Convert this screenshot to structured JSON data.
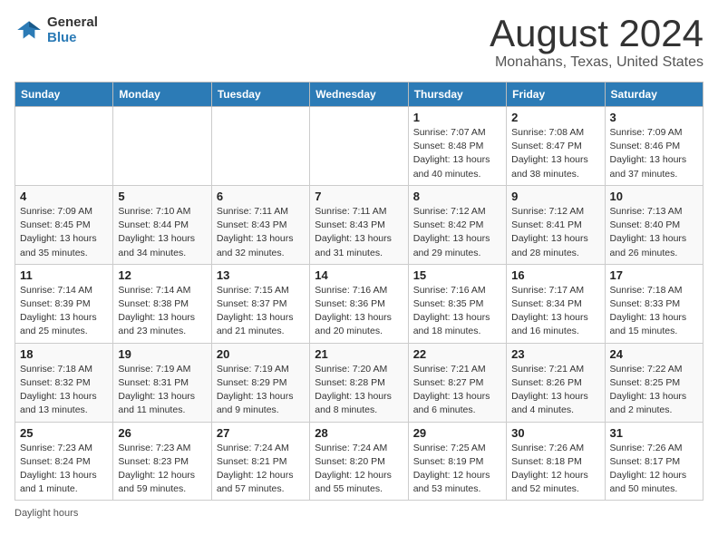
{
  "header": {
    "logo_line1": "General",
    "logo_line2": "Blue",
    "month_year": "August 2024",
    "location": "Monahans, Texas, United States"
  },
  "days_of_week": [
    "Sunday",
    "Monday",
    "Tuesday",
    "Wednesday",
    "Thursday",
    "Friday",
    "Saturday"
  ],
  "footer": {
    "daylight_label": "Daylight hours"
  },
  "weeks": [
    [
      {
        "day": "",
        "info": ""
      },
      {
        "day": "",
        "info": ""
      },
      {
        "day": "",
        "info": ""
      },
      {
        "day": "",
        "info": ""
      },
      {
        "day": "1",
        "info": "Sunrise: 7:07 AM\nSunset: 8:48 PM\nDaylight: 13 hours\nand 40 minutes."
      },
      {
        "day": "2",
        "info": "Sunrise: 7:08 AM\nSunset: 8:47 PM\nDaylight: 13 hours\nand 38 minutes."
      },
      {
        "day": "3",
        "info": "Sunrise: 7:09 AM\nSunset: 8:46 PM\nDaylight: 13 hours\nand 37 minutes."
      }
    ],
    [
      {
        "day": "4",
        "info": "Sunrise: 7:09 AM\nSunset: 8:45 PM\nDaylight: 13 hours\nand 35 minutes."
      },
      {
        "day": "5",
        "info": "Sunrise: 7:10 AM\nSunset: 8:44 PM\nDaylight: 13 hours\nand 34 minutes."
      },
      {
        "day": "6",
        "info": "Sunrise: 7:11 AM\nSunset: 8:43 PM\nDaylight: 13 hours\nand 32 minutes."
      },
      {
        "day": "7",
        "info": "Sunrise: 7:11 AM\nSunset: 8:43 PM\nDaylight: 13 hours\nand 31 minutes."
      },
      {
        "day": "8",
        "info": "Sunrise: 7:12 AM\nSunset: 8:42 PM\nDaylight: 13 hours\nand 29 minutes."
      },
      {
        "day": "9",
        "info": "Sunrise: 7:12 AM\nSunset: 8:41 PM\nDaylight: 13 hours\nand 28 minutes."
      },
      {
        "day": "10",
        "info": "Sunrise: 7:13 AM\nSunset: 8:40 PM\nDaylight: 13 hours\nand 26 minutes."
      }
    ],
    [
      {
        "day": "11",
        "info": "Sunrise: 7:14 AM\nSunset: 8:39 PM\nDaylight: 13 hours\nand 25 minutes."
      },
      {
        "day": "12",
        "info": "Sunrise: 7:14 AM\nSunset: 8:38 PM\nDaylight: 13 hours\nand 23 minutes."
      },
      {
        "day": "13",
        "info": "Sunrise: 7:15 AM\nSunset: 8:37 PM\nDaylight: 13 hours\nand 21 minutes."
      },
      {
        "day": "14",
        "info": "Sunrise: 7:16 AM\nSunset: 8:36 PM\nDaylight: 13 hours\nand 20 minutes."
      },
      {
        "day": "15",
        "info": "Sunrise: 7:16 AM\nSunset: 8:35 PM\nDaylight: 13 hours\nand 18 minutes."
      },
      {
        "day": "16",
        "info": "Sunrise: 7:17 AM\nSunset: 8:34 PM\nDaylight: 13 hours\nand 16 minutes."
      },
      {
        "day": "17",
        "info": "Sunrise: 7:18 AM\nSunset: 8:33 PM\nDaylight: 13 hours\nand 15 minutes."
      }
    ],
    [
      {
        "day": "18",
        "info": "Sunrise: 7:18 AM\nSunset: 8:32 PM\nDaylight: 13 hours\nand 13 minutes."
      },
      {
        "day": "19",
        "info": "Sunrise: 7:19 AM\nSunset: 8:31 PM\nDaylight: 13 hours\nand 11 minutes."
      },
      {
        "day": "20",
        "info": "Sunrise: 7:19 AM\nSunset: 8:29 PM\nDaylight: 13 hours\nand 9 minutes."
      },
      {
        "day": "21",
        "info": "Sunrise: 7:20 AM\nSunset: 8:28 PM\nDaylight: 13 hours\nand 8 minutes."
      },
      {
        "day": "22",
        "info": "Sunrise: 7:21 AM\nSunset: 8:27 PM\nDaylight: 13 hours\nand 6 minutes."
      },
      {
        "day": "23",
        "info": "Sunrise: 7:21 AM\nSunset: 8:26 PM\nDaylight: 13 hours\nand 4 minutes."
      },
      {
        "day": "24",
        "info": "Sunrise: 7:22 AM\nSunset: 8:25 PM\nDaylight: 13 hours\nand 2 minutes."
      }
    ],
    [
      {
        "day": "25",
        "info": "Sunrise: 7:23 AM\nSunset: 8:24 PM\nDaylight: 13 hours\nand 1 minute."
      },
      {
        "day": "26",
        "info": "Sunrise: 7:23 AM\nSunset: 8:23 PM\nDaylight: 12 hours\nand 59 minutes."
      },
      {
        "day": "27",
        "info": "Sunrise: 7:24 AM\nSunset: 8:21 PM\nDaylight: 12 hours\nand 57 minutes."
      },
      {
        "day": "28",
        "info": "Sunrise: 7:24 AM\nSunset: 8:20 PM\nDaylight: 12 hours\nand 55 minutes."
      },
      {
        "day": "29",
        "info": "Sunrise: 7:25 AM\nSunset: 8:19 PM\nDaylight: 12 hours\nand 53 minutes."
      },
      {
        "day": "30",
        "info": "Sunrise: 7:26 AM\nSunset: 8:18 PM\nDaylight: 12 hours\nand 52 minutes."
      },
      {
        "day": "31",
        "info": "Sunrise: 7:26 AM\nSunset: 8:17 PM\nDaylight: 12 hours\nand 50 minutes."
      }
    ]
  ]
}
